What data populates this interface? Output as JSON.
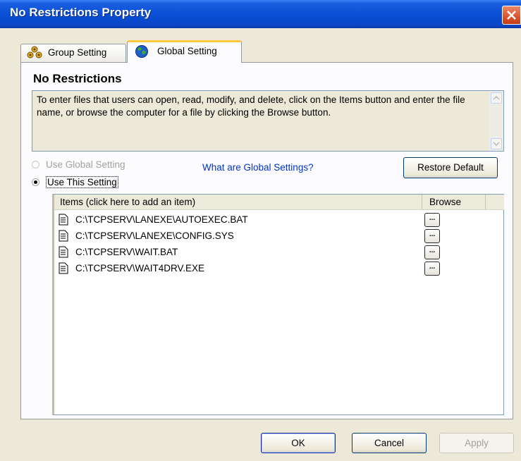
{
  "window": {
    "title": "No Restrictions Property"
  },
  "tabs": [
    {
      "label": "Group Setting",
      "icon": "group-icon",
      "selected": false
    },
    {
      "label": "Global Setting",
      "icon": "globe-icon",
      "selected": true
    }
  ],
  "panel": {
    "heading": "No Restrictions",
    "description": "To enter files that users can open, read, modify, and delete, click on the Items button and enter the file name, or browse the computer for a file by clicking the Browse button."
  },
  "options": {
    "use_global": {
      "label": "Use Global Setting",
      "checked": false,
      "enabled": false
    },
    "use_this": {
      "label": "Use This Setting",
      "checked": true,
      "enabled": true
    },
    "link": "What are Global Settings?",
    "restore_button": "Restore Default"
  },
  "list": {
    "columns": [
      "Items (click here to add an item)",
      "Browse"
    ],
    "rows": [
      {
        "path": "C:\\TCPSERV\\LANEXE\\AUTOEXEC.BAT",
        "browse": "..."
      },
      {
        "path": "C:\\TCPSERV\\LANEXE\\CONFIG.SYS",
        "browse": "..."
      },
      {
        "path": "C:\\TCPSERV\\WAIT.BAT",
        "browse": "..."
      },
      {
        "path": "C:\\TCPSERV\\WAIT4DRV.EXE",
        "browse": "..."
      }
    ]
  },
  "buttons": {
    "ok": "OK",
    "cancel": "Cancel",
    "apply": "Apply"
  },
  "colors": {
    "titlebar": "#0a4fd6",
    "tab_highlight": "#ffc83c",
    "link": "#0033cc",
    "close": "#d9542b"
  }
}
